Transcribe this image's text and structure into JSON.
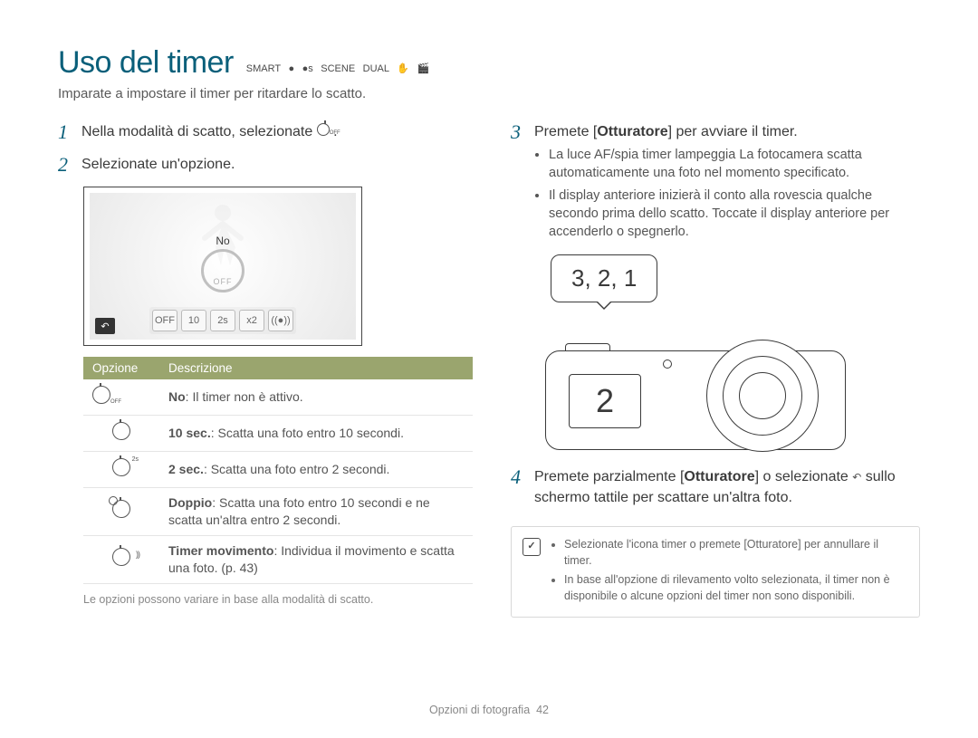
{
  "header": {
    "title": "Uso del timer",
    "mode_icons": [
      "SMART",
      "●",
      "●s",
      "SCENE",
      "DUAL",
      "✋",
      "🎬"
    ]
  },
  "subtitle": "Imparate a impostare il timer per ritardare lo scatto.",
  "left": {
    "step1_num": "1",
    "step1_text_a": "Nella modalità di scatto, selezionate ",
    "step1_text_b": ".",
    "step2_num": "2",
    "step2_text": "Selezionate un'opzione.",
    "screen": {
      "label": "No",
      "off": "OFF",
      "options": [
        "OFF",
        "10",
        "2s",
        "x2",
        "((●))"
      ],
      "back": "↶"
    },
    "table": {
      "h1": "Opzione",
      "h2": "Descrizione",
      "rows": [
        {
          "label_b": "No",
          "label_r": ": Il timer non è attivo."
        },
        {
          "label_b": "10 sec.",
          "label_r": ": Scatta una foto entro 10 secondi."
        },
        {
          "label_b": "2 sec.",
          "label_r": ": Scatta una foto entro 2 secondi."
        },
        {
          "label_b": "Doppio",
          "label_r": ": Scatta una foto entro 10 secondi e ne scatta un'altra entro 2 secondi."
        },
        {
          "label_b": "Timer movimento",
          "label_r": ": Individua il movimento e scatta una foto. (p. 43)"
        }
      ]
    },
    "footnote": "Le opzioni possono variare in base alla modalità di scatto."
  },
  "right": {
    "step3_num": "3",
    "step3_text_a": "Premete [",
    "step3_text_b": "Otturatore",
    "step3_text_c": "] per avviare il timer.",
    "step3_bullets": [
      "La luce AF/spia timer lampeggia La fotocamera scatta automaticamente una foto nel momento specificato.",
      "Il display anteriore inizierà il conto alla rovescia qualche secondo prima dello scatto. Toccate il display anteriore per accenderlo o spegnerlo."
    ],
    "speech": "3, 2, 1",
    "camera_count": "2",
    "step4_num": "4",
    "step4_text_a": "Premete parzialmente [",
    "step4_text_b": "Otturatore",
    "step4_text_c": "] o selezionate ",
    "step4_text_d": " sullo schermo tattile per scattare un'altra foto.",
    "note_icon": "✓",
    "notes": [
      "Selezionate l'icona timer o premete [Otturatore] per annullare il timer.",
      "In base all'opzione di rilevamento volto selezionata, il timer non è disponibile o alcune opzioni del timer non sono disponibili."
    ]
  },
  "footer": {
    "section": "Opzioni di fotografia",
    "page": "42"
  }
}
